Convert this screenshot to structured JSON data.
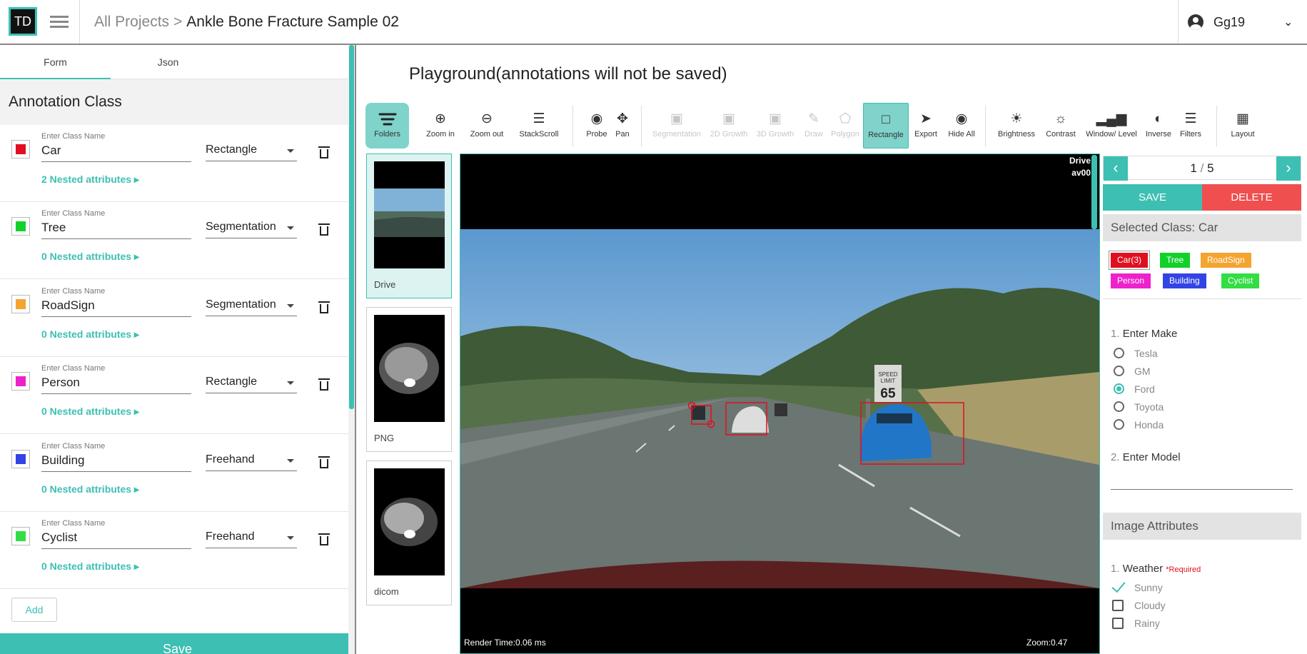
{
  "app": {
    "logo": "TD",
    "breadcrumb_root": "All Projects",
    "breadcrumb_sep": ">",
    "project": "Ankle Bone Fracture Sample 02",
    "user": "Gg19"
  },
  "left": {
    "tabs": [
      {
        "label": "Form"
      },
      {
        "label": "Json"
      }
    ],
    "heading": "Annotation Class",
    "field_label": "Enter Class Name",
    "classes": [
      {
        "name": "Car",
        "type": "Rectangle",
        "nested": "2 Nested attributes ▸",
        "color": "#e01020"
      },
      {
        "name": "Tree",
        "type": "Segmentation",
        "nested": "0 Nested attributes ▸",
        "color": "#12d12a"
      },
      {
        "name": "RoadSign",
        "type": "Segmentation",
        "nested": "0 Nested attributes ▸",
        "color": "#f4a430"
      },
      {
        "name": "Person",
        "type": "Rectangle",
        "nested": "0 Nested attributes ▸",
        "color": "#ee22cc"
      },
      {
        "name": "Building",
        "type": "Freehand",
        "nested": "0 Nested attributes ▸",
        "color": "#3344e6"
      },
      {
        "name": "Cyclist",
        "type": "Freehand",
        "nested": "0 Nested attributes ▸",
        "color": "#33dd44"
      }
    ],
    "add_label": "Add",
    "save_label": "Save"
  },
  "playground": {
    "title": "Playground(annotations will not be saved)"
  },
  "toolbar": {
    "folders": "Folders",
    "zoom_in": "Zoom in",
    "zoom_out": "Zoom out",
    "stackscroll": "StackScroll",
    "probe": "Probe",
    "pan": "Pan",
    "segmentation": "Segmentation",
    "growth2d": "2D Growth",
    "growth3d": "3D Growth",
    "draw": "Draw",
    "polygon": "Polygon",
    "rectangle": "Rectangle",
    "export": "Export",
    "hide_all": "Hide All",
    "brightness": "Brightness",
    "contrast": "Contrast",
    "window_level": "Window/ Level",
    "inverse": "Inverse",
    "filters": "Filters",
    "layout": "Layout"
  },
  "thumbnails": [
    {
      "label": "Drive"
    },
    {
      "label": "PNG"
    },
    {
      "label": "dicom"
    }
  ],
  "viewer": {
    "overlay_tr1": "Drive",
    "overlay_tr2": "av00",
    "render_time": "Render Time:0.06 ms",
    "zoom": "Zoom:0.47",
    "sign": [
      "SPEED",
      "LIMIT",
      "65"
    ]
  },
  "right": {
    "page_current": "1",
    "page_sep": "/",
    "page_total": "5",
    "save": "SAVE",
    "delete": "DELETE",
    "selected_class": "Selected Class: Car",
    "chips": [
      {
        "label": "Car(3)",
        "color": "#e01020"
      },
      {
        "label": "Tree",
        "color": "#12d12a"
      },
      {
        "label": "RoadSign",
        "color": "#f4a430"
      },
      {
        "label": "Person",
        "color": "#ee22cc"
      },
      {
        "label": "Building",
        "color": "#3344e6"
      },
      {
        "label": "Cyclist",
        "color": "#33dd44"
      }
    ],
    "q1_num": "1.",
    "q1": "Enter Make",
    "makes": [
      "Tesla",
      "GM",
      "Ford",
      "Toyota",
      "Honda"
    ],
    "make_selected": "Ford",
    "q2_num": "2.",
    "q2": "Enter Model",
    "image_attributes": "Image Attributes",
    "w_num": "1.",
    "weather": "Weather",
    "required": "*Required",
    "weather_options": [
      "Sunny",
      "Cloudy",
      "Rainy"
    ],
    "weather_checked": "Sunny"
  }
}
